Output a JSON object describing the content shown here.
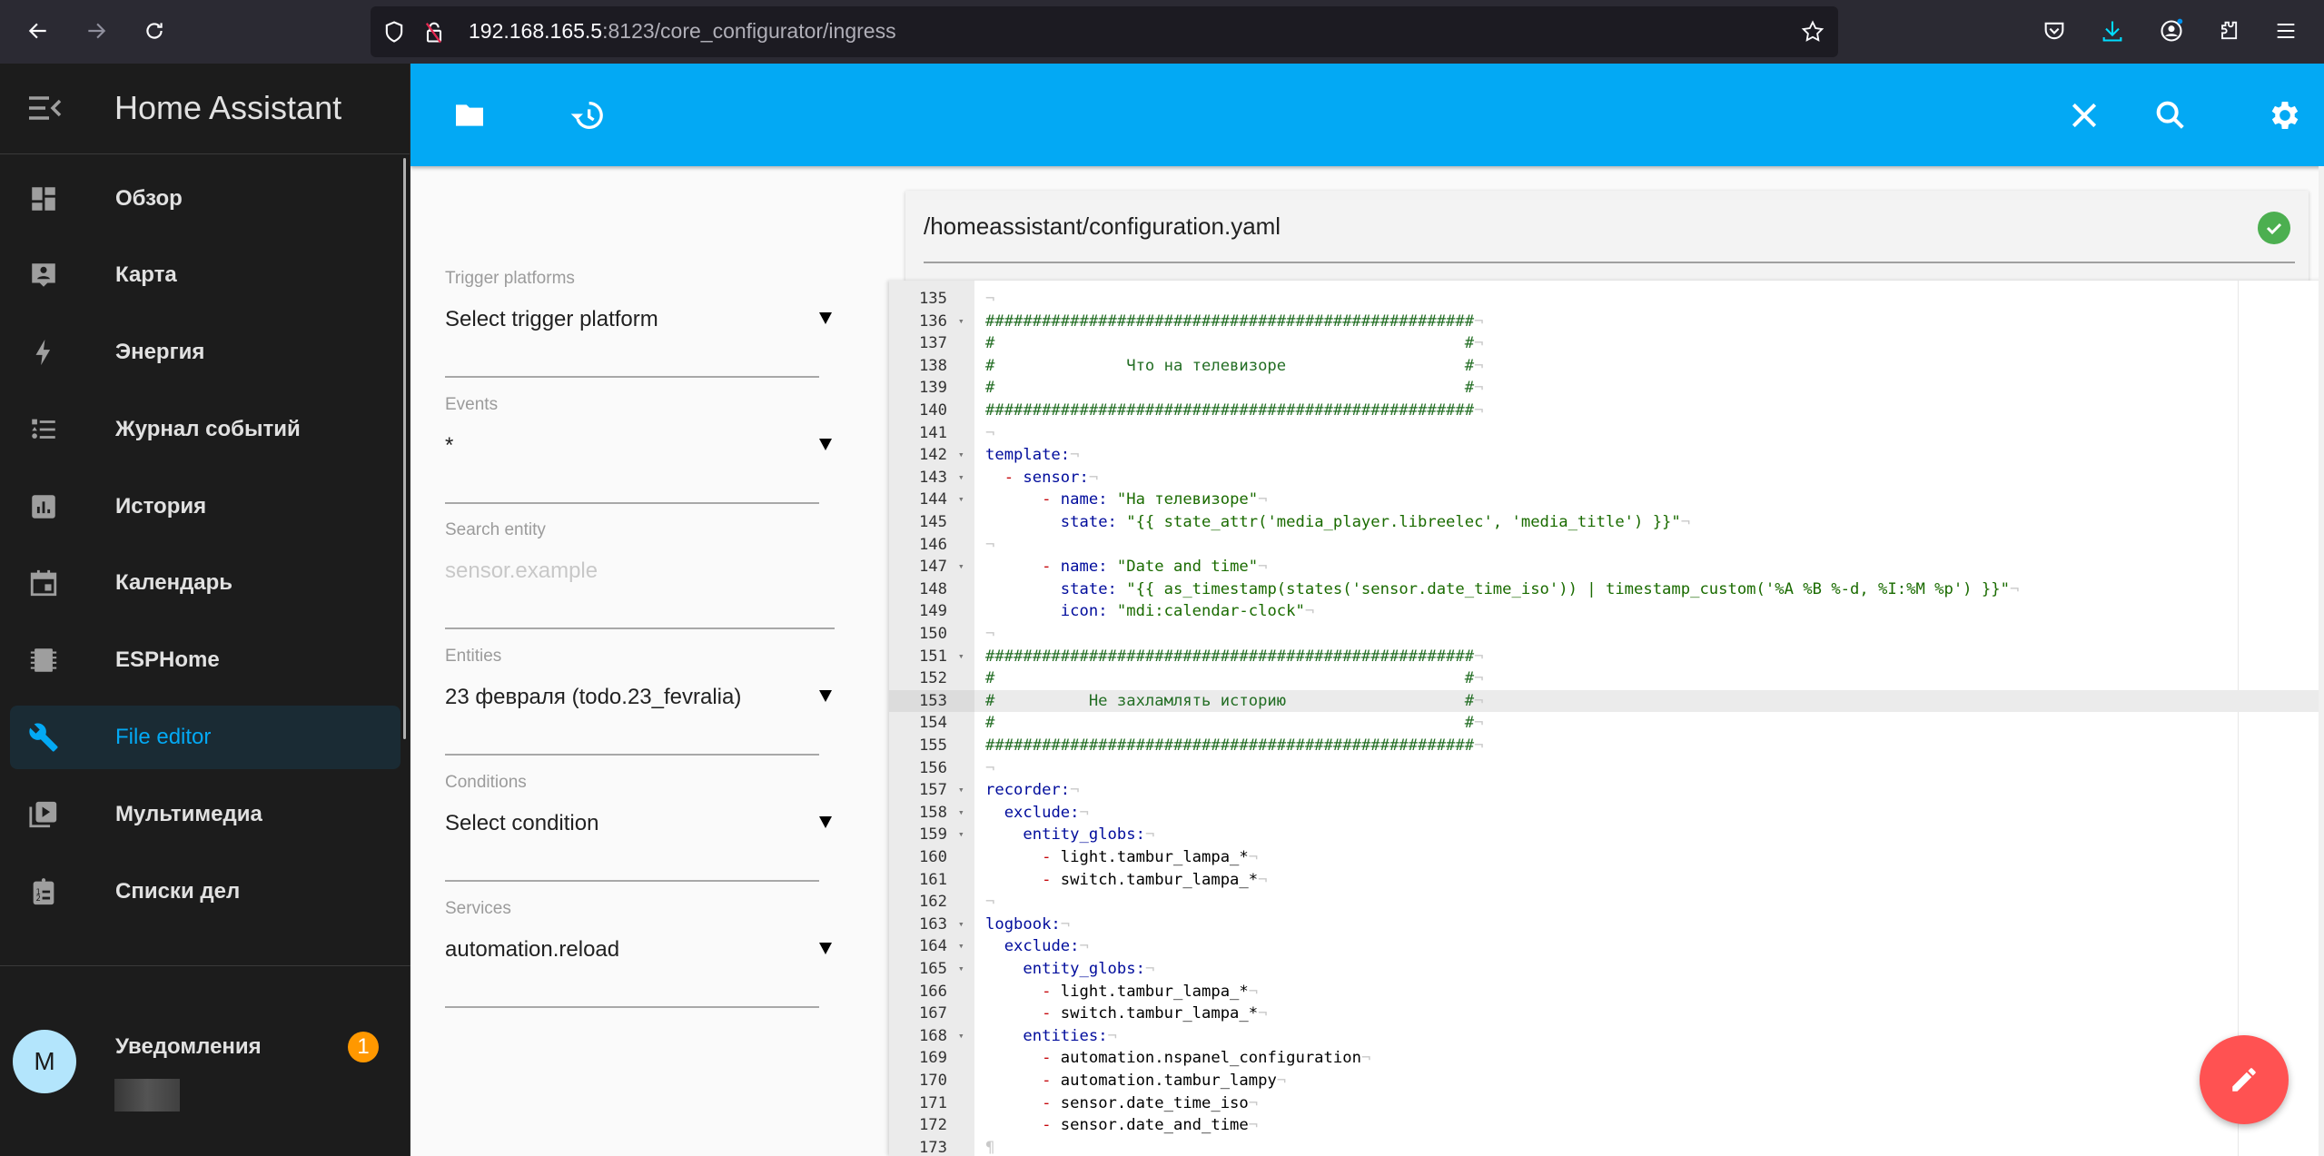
{
  "browser": {
    "url_host": "192.168.165.5",
    "url_path": ":8123/core_configurator/ingress"
  },
  "sidebar": {
    "title": "Home Assistant",
    "items": [
      {
        "label": "Обзор",
        "icon": "view-dashboard-icon"
      },
      {
        "label": "Карта",
        "icon": "map-account-icon"
      },
      {
        "label": "Энергия",
        "icon": "lightning-bolt-icon"
      },
      {
        "label": "Журнал событий",
        "icon": "format-list-bulleted-type-icon"
      },
      {
        "label": "История",
        "icon": "chart-box-icon"
      },
      {
        "label": "Календарь",
        "icon": "calendar-icon"
      },
      {
        "label": "ESPHome",
        "icon": "chip-icon"
      },
      {
        "label": "File editor",
        "icon": "wrench-icon",
        "active": true
      },
      {
        "label": "Мультимедиа",
        "icon": "play-box-multiple-icon"
      },
      {
        "label": "Списки дел",
        "icon": "clipboard-list-icon"
      }
    ],
    "notifications": {
      "label": "Уведомления",
      "count": "1"
    },
    "user": {
      "initial": "M"
    }
  },
  "appbar": {
    "left_icons": [
      "folder-icon",
      "history-icon"
    ],
    "right_icons": [
      "close-icon",
      "search-icon",
      "settings-icon"
    ]
  },
  "form": {
    "trigger": {
      "label": "Trigger platforms",
      "value": "Select trigger platform"
    },
    "events": {
      "label": "Events",
      "value": "*"
    },
    "search": {
      "label": "Search entity",
      "placeholder": "sensor.example"
    },
    "entities": {
      "label": "Entities",
      "value": "23 февраля (todo.23_fevralia)"
    },
    "conditions": {
      "label": "Conditions",
      "value": "Select condition"
    },
    "services": {
      "label": "Services",
      "value": "automation.reload"
    }
  },
  "file": {
    "path": "/homeassistant/configuration.yaml",
    "status": "valid",
    "status_color": "#4caf50"
  },
  "editor": {
    "active_line": 153,
    "lines": [
      {
        "n": 135,
        "fold": false,
        "segs": []
      },
      {
        "n": 136,
        "fold": true,
        "segs": [
          [
            "c-com",
            "####################################################"
          ]
        ]
      },
      {
        "n": 137,
        "fold": false,
        "segs": [
          [
            "c-com",
            "#                                                  #"
          ]
        ]
      },
      {
        "n": 138,
        "fold": false,
        "segs": [
          [
            "c-com",
            "#              Что на телевизоре                   #"
          ]
        ]
      },
      {
        "n": 139,
        "fold": false,
        "segs": [
          [
            "c-com",
            "#                                                  #"
          ]
        ]
      },
      {
        "n": 140,
        "fold": false,
        "segs": [
          [
            "c-com",
            "####################################################"
          ]
        ]
      },
      {
        "n": 141,
        "fold": false,
        "segs": []
      },
      {
        "n": 142,
        "fold": true,
        "segs": [
          [
            "c-key",
            "template:"
          ]
        ]
      },
      {
        "n": 143,
        "fold": true,
        "segs": [
          [
            "",
            "  "
          ],
          [
            "c-dash",
            "- "
          ],
          [
            "c-key",
            "sensor:"
          ]
        ]
      },
      {
        "n": 144,
        "fold": true,
        "segs": [
          [
            "",
            "      "
          ],
          [
            "c-dash",
            "- "
          ],
          [
            "c-key",
            "name: "
          ],
          [
            "c-str",
            "\"На телевизоре\""
          ]
        ]
      },
      {
        "n": 145,
        "fold": false,
        "segs": [
          [
            "",
            "        "
          ],
          [
            "c-key",
            "state: "
          ],
          [
            "c-str",
            "\"{{ state_attr('media_player.libreelec', 'media_title') }}\""
          ]
        ]
      },
      {
        "n": 146,
        "fold": false,
        "segs": []
      },
      {
        "n": 147,
        "fold": true,
        "segs": [
          [
            "",
            "      "
          ],
          [
            "c-dash",
            "- "
          ],
          [
            "c-key",
            "name: "
          ],
          [
            "c-str",
            "\"Date and time\""
          ]
        ]
      },
      {
        "n": 148,
        "fold": false,
        "segs": [
          [
            "",
            "        "
          ],
          [
            "c-key",
            "state: "
          ],
          [
            "c-str",
            "\"{{ as_timestamp(states('sensor.date_time_iso')) | timestamp_custom('%A %B %-d, %I:%M %p') }}\""
          ]
        ]
      },
      {
        "n": 149,
        "fold": false,
        "segs": [
          [
            "",
            "        "
          ],
          [
            "c-key",
            "icon: "
          ],
          [
            "c-str",
            "\"mdi:calendar-clock\""
          ]
        ]
      },
      {
        "n": 150,
        "fold": false,
        "segs": []
      },
      {
        "n": 151,
        "fold": true,
        "segs": [
          [
            "c-com",
            "####################################################"
          ]
        ]
      },
      {
        "n": 152,
        "fold": false,
        "segs": [
          [
            "c-com",
            "#                                                  #"
          ]
        ]
      },
      {
        "n": 153,
        "fold": false,
        "segs": [
          [
            "c-com",
            "#          Не захламлять историю                   #"
          ]
        ]
      },
      {
        "n": 154,
        "fold": false,
        "segs": [
          [
            "c-com",
            "#                                                  #"
          ]
        ]
      },
      {
        "n": 155,
        "fold": false,
        "segs": [
          [
            "c-com",
            "####################################################"
          ]
        ]
      },
      {
        "n": 156,
        "fold": false,
        "segs": []
      },
      {
        "n": 157,
        "fold": true,
        "segs": [
          [
            "c-key",
            "recorder:"
          ]
        ]
      },
      {
        "n": 158,
        "fold": true,
        "segs": [
          [
            "",
            "  "
          ],
          [
            "c-key",
            "exclude:"
          ]
        ]
      },
      {
        "n": 159,
        "fold": true,
        "segs": [
          [
            "",
            "    "
          ],
          [
            "c-key",
            "entity_globs:"
          ]
        ]
      },
      {
        "n": 160,
        "fold": false,
        "segs": [
          [
            "",
            "      "
          ],
          [
            "c-dash",
            "- "
          ],
          [
            "",
            "light.tambur_lampa_*"
          ]
        ]
      },
      {
        "n": 161,
        "fold": false,
        "segs": [
          [
            "",
            "      "
          ],
          [
            "c-dash",
            "- "
          ],
          [
            "",
            "switch.tambur_lampa_*"
          ]
        ]
      },
      {
        "n": 162,
        "fold": false,
        "segs": []
      },
      {
        "n": 163,
        "fold": true,
        "segs": [
          [
            "c-key",
            "logbook:"
          ]
        ]
      },
      {
        "n": 164,
        "fold": true,
        "segs": [
          [
            "",
            "  "
          ],
          [
            "c-key",
            "exclude:"
          ]
        ]
      },
      {
        "n": 165,
        "fold": true,
        "segs": [
          [
            "",
            "    "
          ],
          [
            "c-key",
            "entity_globs:"
          ]
        ]
      },
      {
        "n": 166,
        "fold": false,
        "segs": [
          [
            "",
            "      "
          ],
          [
            "c-dash",
            "- "
          ],
          [
            "",
            "light.tambur_lampa_*"
          ]
        ]
      },
      {
        "n": 167,
        "fold": false,
        "segs": [
          [
            "",
            "      "
          ],
          [
            "c-dash",
            "- "
          ],
          [
            "",
            "switch.tambur_lampa_*"
          ]
        ]
      },
      {
        "n": 168,
        "fold": true,
        "segs": [
          [
            "",
            "    "
          ],
          [
            "c-key",
            "entities:"
          ]
        ]
      },
      {
        "n": 169,
        "fold": false,
        "segs": [
          [
            "",
            "      "
          ],
          [
            "c-dash",
            "- "
          ],
          [
            "",
            "automation.nspanel_configuration"
          ]
        ]
      },
      {
        "n": 170,
        "fold": false,
        "segs": [
          [
            "",
            "      "
          ],
          [
            "c-dash",
            "- "
          ],
          [
            "",
            "automation.tambur_lampy"
          ]
        ]
      },
      {
        "n": 171,
        "fold": false,
        "segs": [
          [
            "",
            "      "
          ],
          [
            "c-dash",
            "- "
          ],
          [
            "",
            "sensor.date_time_iso"
          ]
        ]
      },
      {
        "n": 172,
        "fold": false,
        "segs": [
          [
            "",
            "      "
          ],
          [
            "c-dash",
            "- "
          ],
          [
            "",
            "sensor.date_and_time"
          ]
        ]
      },
      {
        "n": 173,
        "fold": false,
        "segs": [],
        "eof": true
      }
    ]
  },
  "fab": {
    "icon": "pencil-icon",
    "color": "#ff5252"
  }
}
